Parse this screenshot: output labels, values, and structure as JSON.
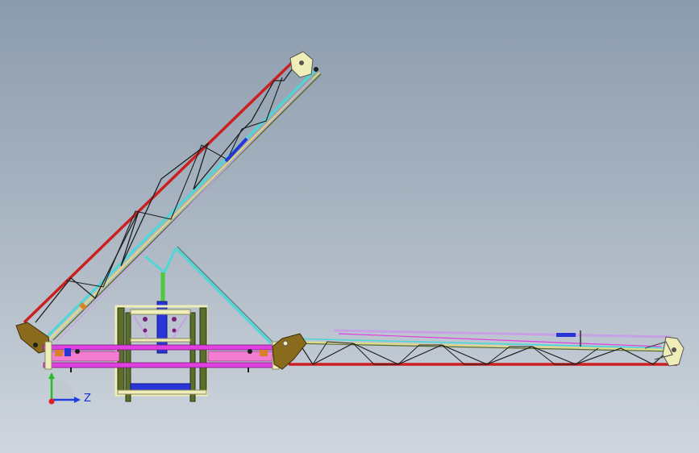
{
  "viewport": {
    "background_top": "#8c9cad",
    "background_bottom": "#cfd6de"
  },
  "model": {
    "description_icon": "truss-boom-assembly",
    "colors": {
      "red_chord": "#cc1f1f",
      "dark_lattice": "#1e1e1e",
      "cyan": "#4fd6d6",
      "yellow": "#e8e26a",
      "magenta": "#e040e0",
      "blue": "#2a35d8",
      "green": "#4ec83c",
      "olive": "#5b6e2a",
      "tan": "#8a6a1c",
      "lavender": "#c7a0e6",
      "cream": "#f0eeb8",
      "pink": "#f37bd0",
      "orange": "#d8802a"
    }
  },
  "triad": {
    "z_label": "Z",
    "x_color": "#e02020",
    "y_color": "#20c020",
    "z_color": "#2040e0"
  }
}
